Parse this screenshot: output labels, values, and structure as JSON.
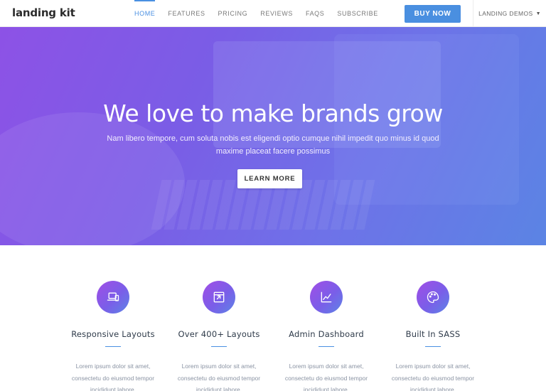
{
  "navbar": {
    "brand": "landing kit",
    "links": [
      "HOME",
      "FEATURES",
      "PRICING",
      "REVIEWS",
      "FAQS",
      "SUBSCRIBE"
    ],
    "active_link": "HOME",
    "buy_label": "BUY NOW",
    "demos_label": "LANDING DEMOS",
    "demos_icon": "chevron-down-icon"
  },
  "hero": {
    "title": "We love to make brands grow",
    "subtitle": "Nam libero tempore, cum soluta nobis est eligendi optio cumque nihil impedit quo minus id quod maxime placeat facere possimus",
    "cta_label": "LEARN MORE"
  },
  "features": [
    {
      "icon": "devices-icon",
      "title": "Responsive Layouts",
      "text": "Lorem ipsum dolor sit amet, consectetu do eiusmod tempor incididunt labore."
    },
    {
      "icon": "layout-icon",
      "title": "Over 400+ Layouts",
      "text": "Lorem ipsum dolor sit amet, consectetu do eiusmod tempor incididunt labore."
    },
    {
      "icon": "chart-icon",
      "title": "Admin Dashboard",
      "text": "Lorem ipsum dolor sit amet, consectetu do eiusmod tempor incididunt labore."
    },
    {
      "icon": "palette-icon",
      "title": "Built In SASS",
      "text": "Lorem ipsum dolor sit amet, consectetu do eiusmod tempor incididunt labore."
    }
  ],
  "colors": {
    "accent": "#4a90e2",
    "hero_start": "#8d52e6",
    "hero_end": "#5b84e4"
  }
}
